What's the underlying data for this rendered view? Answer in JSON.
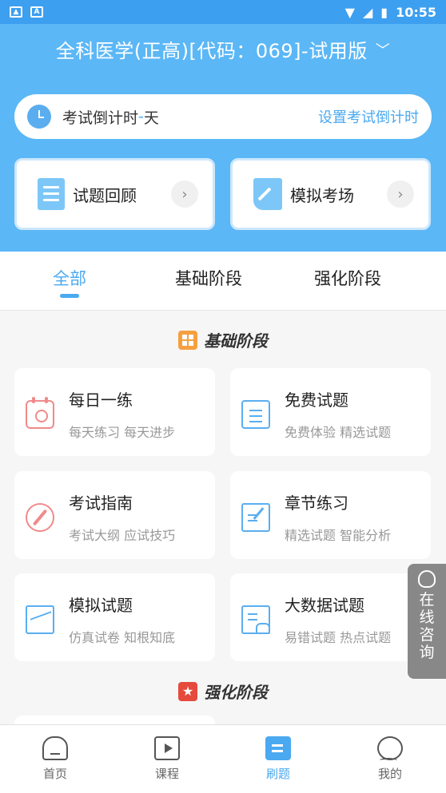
{
  "status_bar": {
    "time": "10:55"
  },
  "header": {
    "title": "全科医学(正高)[代码：069]-试用版"
  },
  "countdown": {
    "label": "考试倒计时",
    "days": " - ",
    "unit": "天",
    "link": "设置考试倒计时"
  },
  "quick_cards": [
    {
      "label": "试题回顾",
      "icon": "document-icon"
    },
    {
      "label": "模拟考场",
      "icon": "pen-icon"
    }
  ],
  "tabs": [
    {
      "label": "全部",
      "active": true
    },
    {
      "label": "基础阶段",
      "active": false
    },
    {
      "label": "强化阶段",
      "active": false
    }
  ],
  "sections": {
    "basic": {
      "title": "基础阶段",
      "cards": [
        {
          "title": "每日一练",
          "subtitle": "每天练习 每天进步",
          "icon": "calendar-icon"
        },
        {
          "title": "免费试题",
          "subtitle": "免费体验 精选试题",
          "icon": "document-icon"
        },
        {
          "title": "考试指南",
          "subtitle": "考试大纲 应试技巧",
          "icon": "compass-icon"
        },
        {
          "title": "章节练习",
          "subtitle": "精选试题 智能分析",
          "icon": "edit-icon"
        },
        {
          "title": "模拟试题",
          "subtitle": "仿真试卷 知根知底",
          "icon": "chart-icon"
        },
        {
          "title": "大数据试题",
          "subtitle": "易错试题 热点试题",
          "icon": "cloud-data-icon"
        }
      ]
    },
    "advanced": {
      "title": "强化阶段"
    }
  },
  "consult": {
    "label": "在线咨询"
  },
  "bottom_nav": [
    {
      "label": "首页",
      "icon": "home-icon"
    },
    {
      "label": "课程",
      "icon": "play-icon"
    },
    {
      "label": "刷题",
      "icon": "quiz-icon",
      "active": true
    },
    {
      "label": "我的",
      "icon": "profile-icon"
    }
  ],
  "colors": {
    "primary": "#5bb7f6",
    "accent": "#4aa9f0",
    "icon_red": "#f08a8a"
  }
}
